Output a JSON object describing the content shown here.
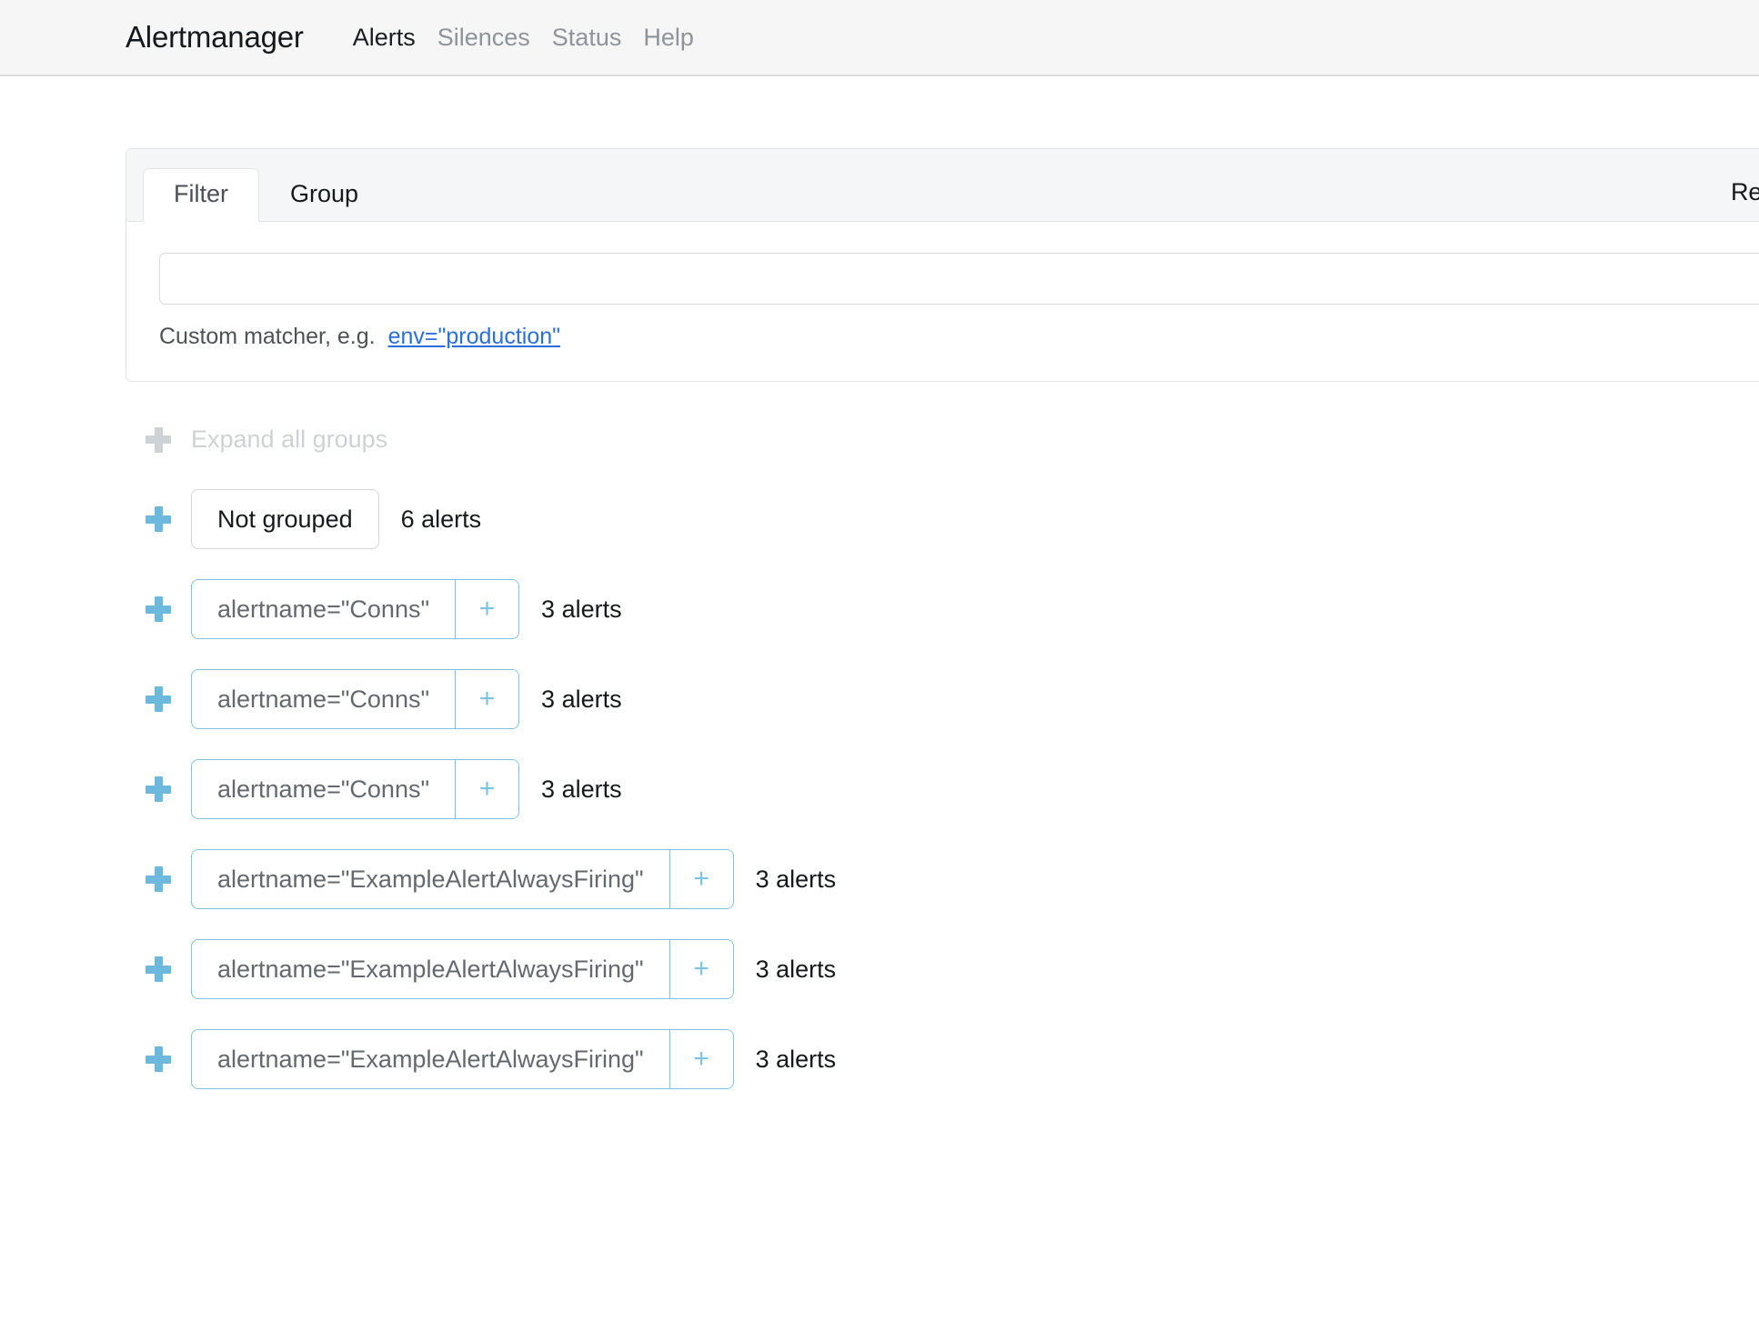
{
  "navbar": {
    "brand": "Alertmanager",
    "links": [
      {
        "label": "Alerts",
        "active": true
      },
      {
        "label": "Silences",
        "active": false
      },
      {
        "label": "Status",
        "active": false
      },
      {
        "label": "Help",
        "active": false
      }
    ]
  },
  "filter_card": {
    "tabs": [
      {
        "label": "Filter",
        "active": true
      },
      {
        "label": "Group",
        "active": false
      }
    ],
    "receiver_label": "Receiver: All",
    "matcher_input_value": "",
    "matcher_input_placeholder": "",
    "help_text": "Custom matcher, e.g.",
    "help_example": "env=\"production\""
  },
  "groups_section": {
    "expand_all_label": "Expand all groups",
    "rows": [
      {
        "label": "Not grouped",
        "count": "6 alerts",
        "teal": false,
        "has_add": false
      },
      {
        "label": "alertname=\"Conns\"",
        "count": "3 alerts",
        "teal": true,
        "has_add": true
      },
      {
        "label": "alertname=\"Conns\"",
        "count": "3 alerts",
        "teal": true,
        "has_add": true
      },
      {
        "label": "alertname=\"Conns\"",
        "count": "3 alerts",
        "teal": true,
        "has_add": true
      },
      {
        "label": "alertname=\"ExampleAlertAlwaysFiring\"",
        "count": "3 alerts",
        "teal": true,
        "has_add": true
      },
      {
        "label": "alertname=\"ExampleAlertAlwaysFiring\"",
        "count": "3 alerts",
        "teal": true,
        "has_add": true
      },
      {
        "label": "alertname=\"ExampleAlertAlwaysFiring\"",
        "count": "3 alerts",
        "teal": true,
        "has_add": true
      }
    ],
    "add_button_glyph": "+"
  },
  "colors": {
    "teal": "#7cc3e3",
    "plus_teal": "#6cb9dd",
    "link_blue": "#2a6fdb",
    "muted_grey": "#8e949a",
    "faded_grey": "#cfd2d4"
  }
}
